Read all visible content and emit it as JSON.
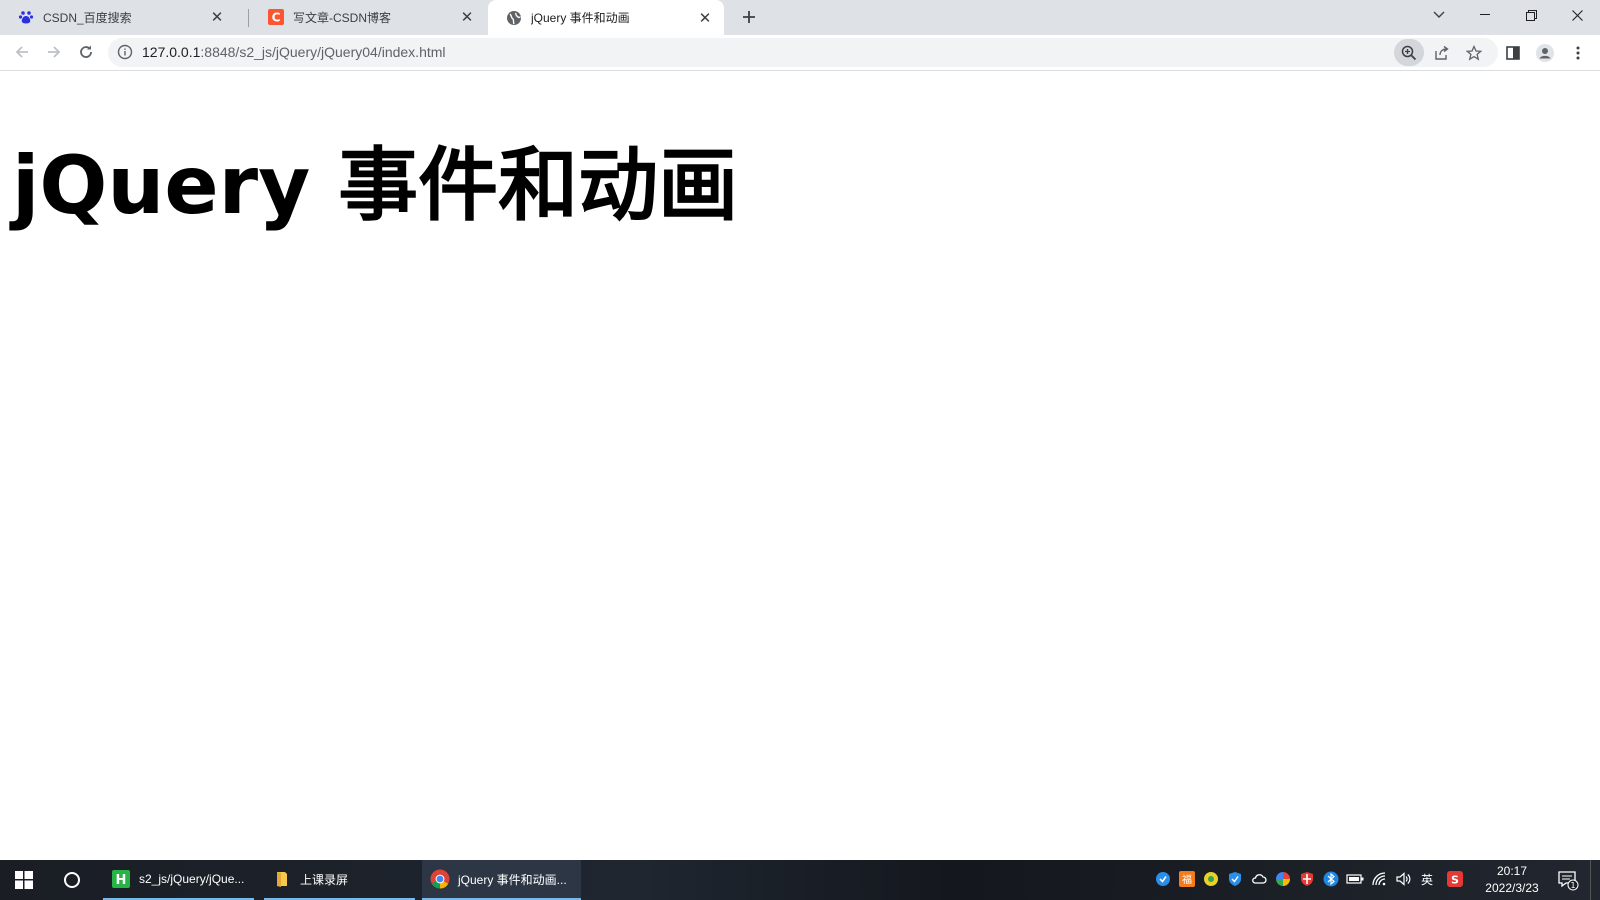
{
  "browser": {
    "tabs": [
      {
        "title": "CSDN_百度搜索",
        "icon": "baidu-paw-icon",
        "active": false
      },
      {
        "title": "写文章-CSDN博客",
        "icon": "csdn-c-icon",
        "active": false
      },
      {
        "title": "jQuery 事件和动画",
        "icon": "globe-icon",
        "active": true
      }
    ],
    "url_host": "127.0.0.1",
    "url_path": ":8848/s2_js/jQuery/jQuery04/index.html"
  },
  "page": {
    "heading": "jQuery 事件和动画"
  },
  "taskbar": {
    "apps": [
      {
        "label": "s2_js/jQuery/jQue...",
        "icon": "hbuilder-icon",
        "active": false
      },
      {
        "label": "上课录屏",
        "icon": "folder-icon",
        "active": false
      },
      {
        "label": "jQuery 事件和动画...",
        "icon": "chrome-icon",
        "active": true
      }
    ],
    "ime_label": "英",
    "time": "20:17",
    "date": "2022/3/23",
    "notification_count": "1"
  },
  "colors": {
    "tabstrip_bg": "#dee1e6",
    "taskbar_bg": "#1b1f27",
    "csdn_red": "#fc5531",
    "baidu_blue": "#2932e1"
  }
}
